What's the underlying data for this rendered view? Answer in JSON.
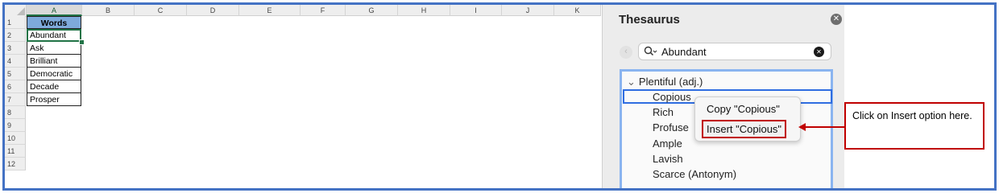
{
  "sheet": {
    "columns": [
      "A",
      "B",
      "C",
      "D",
      "E",
      "F",
      "G",
      "H",
      "I",
      "J",
      "K"
    ],
    "rows": [
      "1",
      "2",
      "3",
      "4",
      "5",
      "6",
      "7",
      "8",
      "9",
      "10",
      "11",
      "12"
    ],
    "cells": [
      "Words",
      "Abundant",
      "Ask",
      "Brilliant",
      "Democratic",
      "Decade",
      "Prosper"
    ],
    "header_color": "#7eaadb",
    "selection_color": "#217346"
  },
  "thesaurus": {
    "title": "Thesaurus",
    "close_icon": "close-icon",
    "search_value": "Abundant",
    "group_label": "Plentiful (adj.)",
    "synonyms": [
      "Copious",
      "Rich",
      "Profuse",
      "Ample",
      "Lavish",
      "Scarce (Antonym)"
    ],
    "accent_color": "#2f6de1"
  },
  "context_menu": {
    "copy_label": "Copy \"Copious\"",
    "insert_label": "Insert \"Copious\""
  },
  "callout": {
    "text": "Click on Insert option here.",
    "color": "#c00000"
  },
  "frame_color": "#4472c4"
}
